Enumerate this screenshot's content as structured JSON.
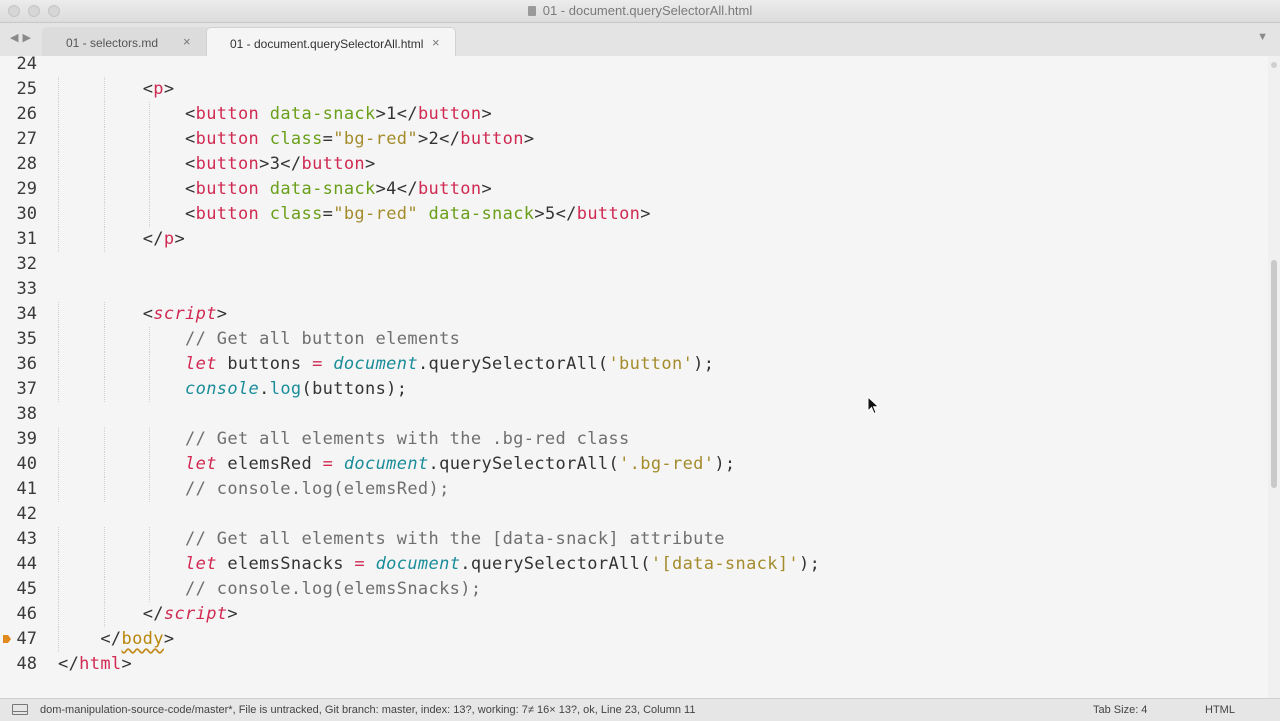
{
  "window": {
    "title": "01 - document.querySelectorAll.html"
  },
  "tabs": [
    {
      "label": "01 - selectors.md",
      "active": false
    },
    {
      "label": "01 - document.querySelectorAll.html",
      "active": true
    }
  ],
  "icons": {
    "back": "back-arrow-icon",
    "forward": "forward-arrow-icon",
    "close": "close-icon",
    "tabs_menu": "chevron-down-icon",
    "bookmark": "bookmark-icon",
    "panel": "panel-icon",
    "cursor": "mouse-cursor-icon"
  },
  "glyphs": {
    "back": "◀",
    "forward": "▶",
    "close": "×",
    "tabs_menu": "▼"
  },
  "colors": {
    "tag": "#d02a52",
    "attribute": "#6a9f1a",
    "string": "#a48b2c",
    "keyword": "#d02a52",
    "builtin": "#1b8d99",
    "comment": "#6f6f6f",
    "bookmark": "#e08a1e"
  },
  "editor": {
    "lines": [
      {
        "n": "24",
        "indent": 0,
        "tokens": []
      },
      {
        "n": "25",
        "indent": 2,
        "tokens": [
          [
            "p",
            "<"
          ],
          [
            "t",
            "p"
          ],
          [
            "p",
            ">"
          ]
        ]
      },
      {
        "n": "26",
        "indent": 3,
        "tokens": [
          [
            "p",
            "<"
          ],
          [
            "t",
            "button"
          ],
          [
            "p",
            " "
          ],
          [
            "a",
            "data-snack"
          ],
          [
            "p",
            ">1</"
          ],
          [
            "t",
            "button"
          ],
          [
            "p",
            ">"
          ]
        ]
      },
      {
        "n": "27",
        "indent": 3,
        "tokens": [
          [
            "p",
            "<"
          ],
          [
            "t",
            "button"
          ],
          [
            "p",
            " "
          ],
          [
            "a",
            "class"
          ],
          [
            "p",
            "="
          ],
          [
            "s",
            "\"bg-red\""
          ],
          [
            "p",
            ">2</"
          ],
          [
            "t",
            "button"
          ],
          [
            "p",
            ">"
          ]
        ]
      },
      {
        "n": "28",
        "indent": 3,
        "tokens": [
          [
            "p",
            "<"
          ],
          [
            "t",
            "button"
          ],
          [
            "p",
            ">3</"
          ],
          [
            "t",
            "button"
          ],
          [
            "p",
            ">"
          ]
        ]
      },
      {
        "n": "29",
        "indent": 3,
        "tokens": [
          [
            "p",
            "<"
          ],
          [
            "t",
            "button"
          ],
          [
            "p",
            " "
          ],
          [
            "a",
            "data-snack"
          ],
          [
            "p",
            ">4</"
          ],
          [
            "t",
            "button"
          ],
          [
            "p",
            ">"
          ]
        ]
      },
      {
        "n": "30",
        "indent": 3,
        "tokens": [
          [
            "p",
            "<"
          ],
          [
            "t",
            "button"
          ],
          [
            "p",
            " "
          ],
          [
            "a",
            "class"
          ],
          [
            "p",
            "="
          ],
          [
            "s",
            "\"bg-red\""
          ],
          [
            "p",
            " "
          ],
          [
            "a",
            "data-snack"
          ],
          [
            "p",
            ">5</"
          ],
          [
            "t",
            "button"
          ],
          [
            "p",
            ">"
          ]
        ]
      },
      {
        "n": "31",
        "indent": 2,
        "tokens": [
          [
            "p",
            "</"
          ],
          [
            "t",
            "p"
          ],
          [
            "p",
            ">"
          ]
        ]
      },
      {
        "n": "32",
        "indent": 0,
        "tokens": []
      },
      {
        "n": "33",
        "indent": 0,
        "tokens": []
      },
      {
        "n": "34",
        "indent": 2,
        "tokens": [
          [
            "p",
            "<"
          ],
          [
            "k",
            "script"
          ],
          [
            "p",
            ">"
          ]
        ]
      },
      {
        "n": "35",
        "indent": 3,
        "tokens": [
          [
            "c",
            "// Get all button elements"
          ]
        ]
      },
      {
        "n": "36",
        "indent": 3,
        "tokens": [
          [
            "k",
            "let"
          ],
          [
            "p",
            " buttons "
          ],
          [
            "o",
            "="
          ],
          [
            "p",
            " "
          ],
          [
            "f",
            "document"
          ],
          [
            "p",
            ".querySelectorAll("
          ],
          [
            "s",
            "'button'"
          ],
          [
            "p",
            ");"
          ]
        ]
      },
      {
        "n": "37",
        "indent": 3,
        "tokens": [
          [
            "f",
            "console"
          ],
          [
            "p",
            "."
          ],
          [
            "m",
            "log"
          ],
          [
            "p",
            "(buttons);"
          ]
        ]
      },
      {
        "n": "38",
        "indent": 0,
        "tokens": []
      },
      {
        "n": "39",
        "indent": 3,
        "tokens": [
          [
            "c",
            "// Get all elements with the .bg-red class"
          ]
        ]
      },
      {
        "n": "40",
        "indent": 3,
        "tokens": [
          [
            "k",
            "let"
          ],
          [
            "p",
            " elemsRed "
          ],
          [
            "o",
            "="
          ],
          [
            "p",
            " "
          ],
          [
            "f",
            "document"
          ],
          [
            "p",
            ".querySelectorAll("
          ],
          [
            "s",
            "'.bg-red'"
          ],
          [
            "p",
            ");"
          ]
        ]
      },
      {
        "n": "41",
        "indent": 3,
        "tokens": [
          [
            "c",
            "// console.log(elemsRed);"
          ]
        ]
      },
      {
        "n": "42",
        "indent": 0,
        "tokens": []
      },
      {
        "n": "43",
        "indent": 3,
        "tokens": [
          [
            "c",
            "// Get all elements with the [data-snack] attribute"
          ]
        ]
      },
      {
        "n": "44",
        "indent": 3,
        "tokens": [
          [
            "k",
            "let"
          ],
          [
            "p",
            " elemsSnacks "
          ],
          [
            "o",
            "="
          ],
          [
            "p",
            " "
          ],
          [
            "f",
            "document"
          ],
          [
            "p",
            ".querySelectorAll("
          ],
          [
            "s",
            "'[data-snack]'"
          ],
          [
            "p",
            ");"
          ]
        ]
      },
      {
        "n": "45",
        "indent": 3,
        "tokens": [
          [
            "c",
            "// console.log(elemsSnacks);"
          ]
        ]
      },
      {
        "n": "46",
        "indent": 2,
        "tokens": [
          [
            "p",
            "</"
          ],
          [
            "k",
            "script"
          ],
          [
            "p",
            ">"
          ]
        ]
      },
      {
        "n": "47",
        "indent": 1,
        "bookmark": true,
        "tokens": [
          [
            "p",
            "</"
          ],
          [
            "b",
            "body"
          ],
          [
            "p",
            ">"
          ]
        ]
      },
      {
        "n": "48",
        "indent": 0,
        "tokens": [
          [
            "p",
            "</"
          ],
          [
            "t",
            "html"
          ],
          [
            "p",
            ">"
          ]
        ]
      }
    ]
  },
  "statusbar": {
    "text": "dom-manipulation-source-code/master*, File is untracked, Git branch: master, index: 13?, working: 7≠ 16× 13?, ok, Line 23, Column 11",
    "tab_size": "Tab Size: 4",
    "syntax": "HTML"
  }
}
